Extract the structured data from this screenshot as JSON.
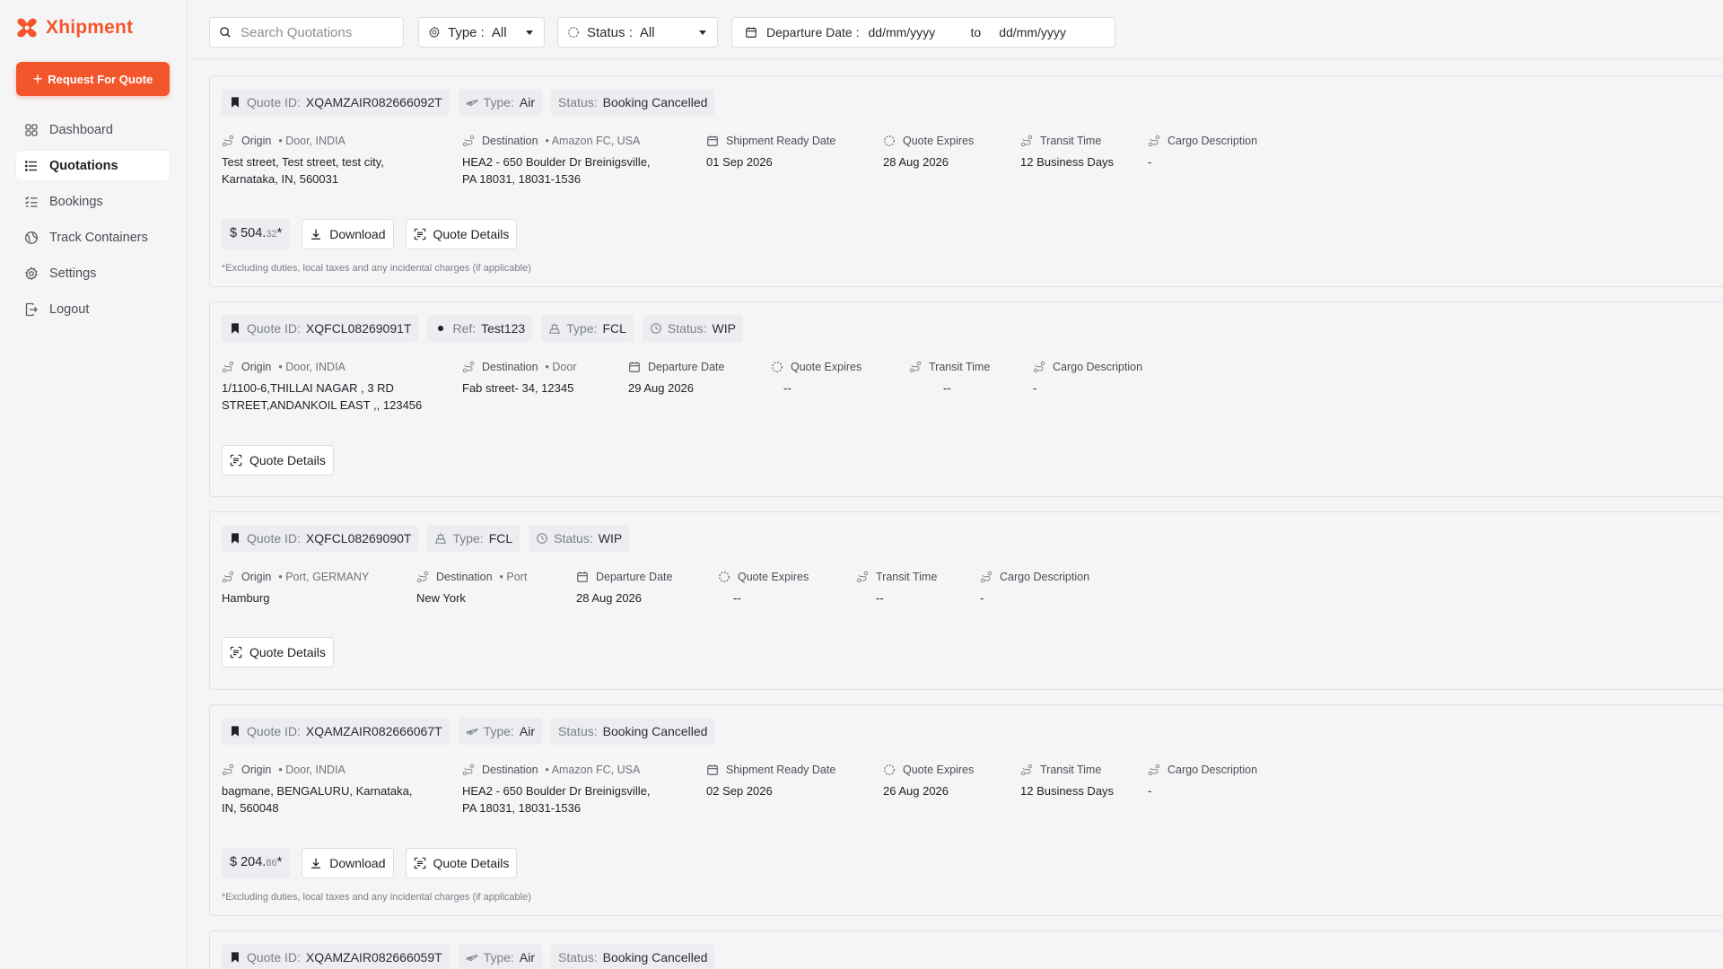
{
  "brand": {
    "name": "Xhipment",
    "color": "#f4562c"
  },
  "sidebar": {
    "cta_label": "Request For Quote",
    "items": [
      {
        "label": "Dashboard",
        "icon": "grid-icon"
      },
      {
        "label": "Quotations",
        "icon": "list-icon",
        "active": true
      },
      {
        "label": "Bookings",
        "icon": "checklist-icon"
      },
      {
        "label": "Track Containers",
        "icon": "globe-icon"
      },
      {
        "label": "Settings",
        "icon": "gear-icon"
      },
      {
        "label": "Logout",
        "icon": "logout-icon"
      }
    ]
  },
  "filters": {
    "search_placeholder": "Search Quotations",
    "type_label": "Type :",
    "type_value": "All",
    "status_label": "Status :",
    "status_value": "All",
    "date_label": "Departure Date :",
    "date_from": "dd/mm/yyyy",
    "date_to_label": "to",
    "date_to": "dd/mm/yyyy"
  },
  "labels": {
    "quote_id": "Quote ID:",
    "type": "Type:",
    "status": "Status:",
    "ref": "Ref:",
    "origin": "Origin",
    "destination": "Destination",
    "shipment_ready": "Shipment Ready Date",
    "departure_date": "Departure Date",
    "quote_expires": "Quote Expires",
    "transit_time": "Transit Time",
    "cargo": "Cargo Description",
    "download": "Download",
    "quote_details": "Quote Details",
    "disclaimer": "*Excluding duties, local taxes and any incidental charges (if applicable)"
  },
  "quotes": [
    {
      "id": "XQAMZAIR082666092T",
      "type": "Air",
      "status": "Booking Cancelled",
      "origin_sub": "• Door, INDIA",
      "origin_l1": "Test street, Test street, test city,",
      "origin_l2": "Karnataka, IN, 560031",
      "dest_sub": "•  Amazon FC, USA",
      "dest_l1": "HEA2 - 650 Boulder Dr Breinigsville,",
      "dest_l2": "PA 18031, 18031-1536",
      "ready_date": "01 Sep 2026",
      "expires": "28 Aug 2026",
      "transit": "12 Business Days",
      "cargo": "-",
      "price_main": "$ 504.",
      "price_cents": "32",
      "price_star": "*"
    },
    {
      "id": "XQFCL08269091T",
      "ref": "Test123",
      "type": "FCL",
      "status": "WIP",
      "origin_sub": "• Door, INDIA",
      "origin_l1": "1/1100-6,THILLAI NAGAR , 3 RD",
      "origin_l2": "STREET,ANDANKOIL EAST ,, 123456",
      "dest_sub": "• Door",
      "dest_l1": "Fab street- 34, 12345",
      "departure": "29 Aug 2026",
      "expires": "--",
      "transit": "--",
      "cargo": "-"
    },
    {
      "id": "XQFCL08269090T",
      "type": "FCL",
      "status": "WIP",
      "origin_sub": "• Port, GERMANY",
      "origin_l1": "Hamburg",
      "dest_sub": "• Port",
      "dest_l1": "New York",
      "departure": "28 Aug 2026",
      "expires": "--",
      "transit": "--",
      "cargo": "-"
    },
    {
      "id": "XQAMZAIR082666067T",
      "type": "Air",
      "status": "Booking Cancelled",
      "origin_sub": "• Door, INDIA",
      "origin_l1": "bagmane, BENGALURU, Karnataka,",
      "origin_l2": "IN, 560048",
      "dest_sub": "•  Amazon FC, USA",
      "dest_l1": "HEA2 - 650 Boulder Dr Breinigsville,",
      "dest_l2": "PA 18031, 18031-1536",
      "ready_date": "02 Sep 2026",
      "expires": "26 Aug 2026",
      "transit": "12 Business Days",
      "cargo": "-",
      "price_main": "$ 204.",
      "price_cents": "86",
      "price_star": "*"
    },
    {
      "id": "XQAMZAIR082666059T",
      "type": "Air",
      "status": "Booking Cancelled"
    }
  ]
}
